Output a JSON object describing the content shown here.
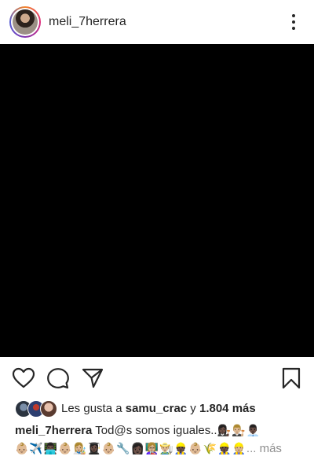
{
  "header": {
    "username": "meli_7herrera"
  },
  "actions": {
    "like_icon": "heart-icon",
    "comment_icon": "comment-icon",
    "share_icon": "paper-plane-icon",
    "save_icon": "bookmark-icon"
  },
  "likes": {
    "prefix": "Les gusta a ",
    "first_user": "samu_crac",
    "connector": " y ",
    "others": "1.804 más"
  },
  "caption": {
    "username": "meli_7herrera",
    "text": " Tod@s somos iguales..",
    "line1_emojis": "👩🏿‍⚖️👨🏼‍⚖️👨🏿‍💼",
    "line2_emojis": "👶🏼✈️👨🏿‍💻👶🏼👩🏼‍🎨👩🏿‍🎓👶🏼🔧👩🏿👩🏼‍🏫👨🏼‍🌾👷🏿👶🏼🌾👷🏿👷🏼",
    "more_label": "... más"
  },
  "colors": {
    "text": "#262626",
    "muted": "#8e8e8e",
    "media_bg": "#000000"
  }
}
